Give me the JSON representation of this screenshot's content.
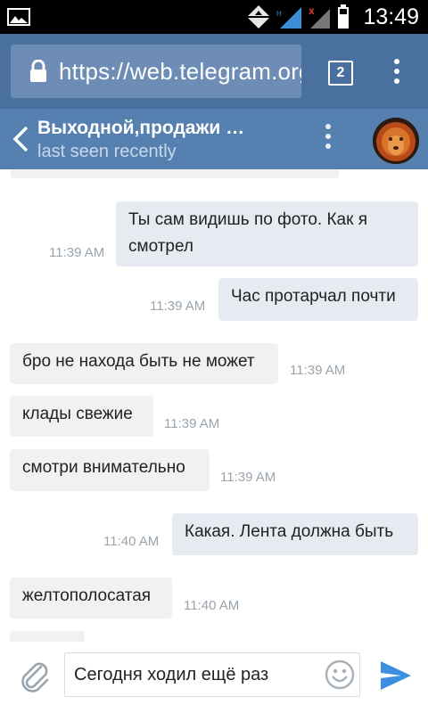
{
  "status_bar": {
    "time": "13:49",
    "icons": [
      "image-notification-icon",
      "data-transfer-icon",
      "signal-icon",
      "signal-no-service-icon",
      "battery-icon"
    ]
  },
  "browser": {
    "url": "https://web.telegram.org",
    "tab_count": "2",
    "accent_color": "#4a70a0"
  },
  "chat": {
    "title": "Выходной,продажи …",
    "status": "last seen recently",
    "header_color": "#5580b0"
  },
  "messages": [
    {
      "direction": "out",
      "text": "Ты сам видишь по фото. Как я смотрел",
      "time": "11:39 AM"
    },
    {
      "direction": "out",
      "text": "Час протарчал почти",
      "time": "11:39 AM"
    },
    {
      "direction": "in",
      "text": "бро не находа быть не может",
      "time": "11:39 AM"
    },
    {
      "direction": "in",
      "text": "клады свежие",
      "time": "11:39 AM"
    },
    {
      "direction": "in",
      "text": "смотри внимательно",
      "time": "11:39 AM"
    },
    {
      "direction": "out",
      "text": "Какая. Лента должна быть",
      "time": "11:40 AM"
    },
    {
      "direction": "in",
      "text": "желтополосатая",
      "time": "11:40 AM"
    }
  ],
  "composer": {
    "value": "Сегодня ходил ещё раз",
    "send_color": "#3d8fe0"
  }
}
